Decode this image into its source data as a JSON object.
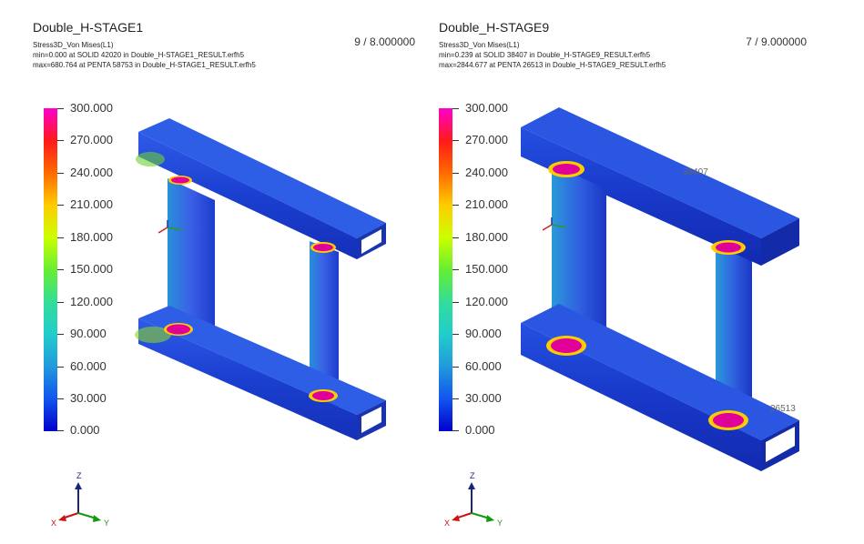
{
  "panels": [
    {
      "title": "Double_H-STAGE1",
      "result_type": "Stress3D_Von Mises(L1)",
      "min_line": "min=0.000 at SOLID 42020 in Double_H-STAGE1_RESULT.erfh5",
      "max_line": "max=680.764 at PENTA 58753 in Double_H-STAGE1_RESULT.erfh5",
      "step": "9 / 8.000000",
      "legend": [
        "300.000",
        "270.000",
        "240.000",
        "210.000",
        "180.000",
        "150.000",
        "120.000",
        "90.000",
        "60.000",
        "30.000",
        "0.000"
      ],
      "node_labels": []
    },
    {
      "title": "Double_H-STAGE9",
      "result_type": "Stress3D_Von Mises(L1)",
      "min_line": "min=0.239 at SOLID 38407 in Double_H-STAGE9_RESULT.erfh5",
      "max_line": "max=2844.677 at PENTA 26513 in Double_H-STAGE9_RESULT.erfh5",
      "step": "7 / 9.000000",
      "legend": [
        "300.000",
        "270.000",
        "240.000",
        "210.000",
        "180.000",
        "150.000",
        "120.000",
        "90.000",
        "60.000",
        "30.000",
        "0.000"
      ],
      "node_labels": [
        "38407",
        "26513"
      ]
    }
  ],
  "triad": {
    "z": "Z",
    "x": "X",
    "y": "Y"
  },
  "colors": {
    "structure": "#1a3fd6",
    "hotspot": "#e0009a",
    "legend_max": "#ff00cc",
    "legend_min": "#0000cc"
  }
}
